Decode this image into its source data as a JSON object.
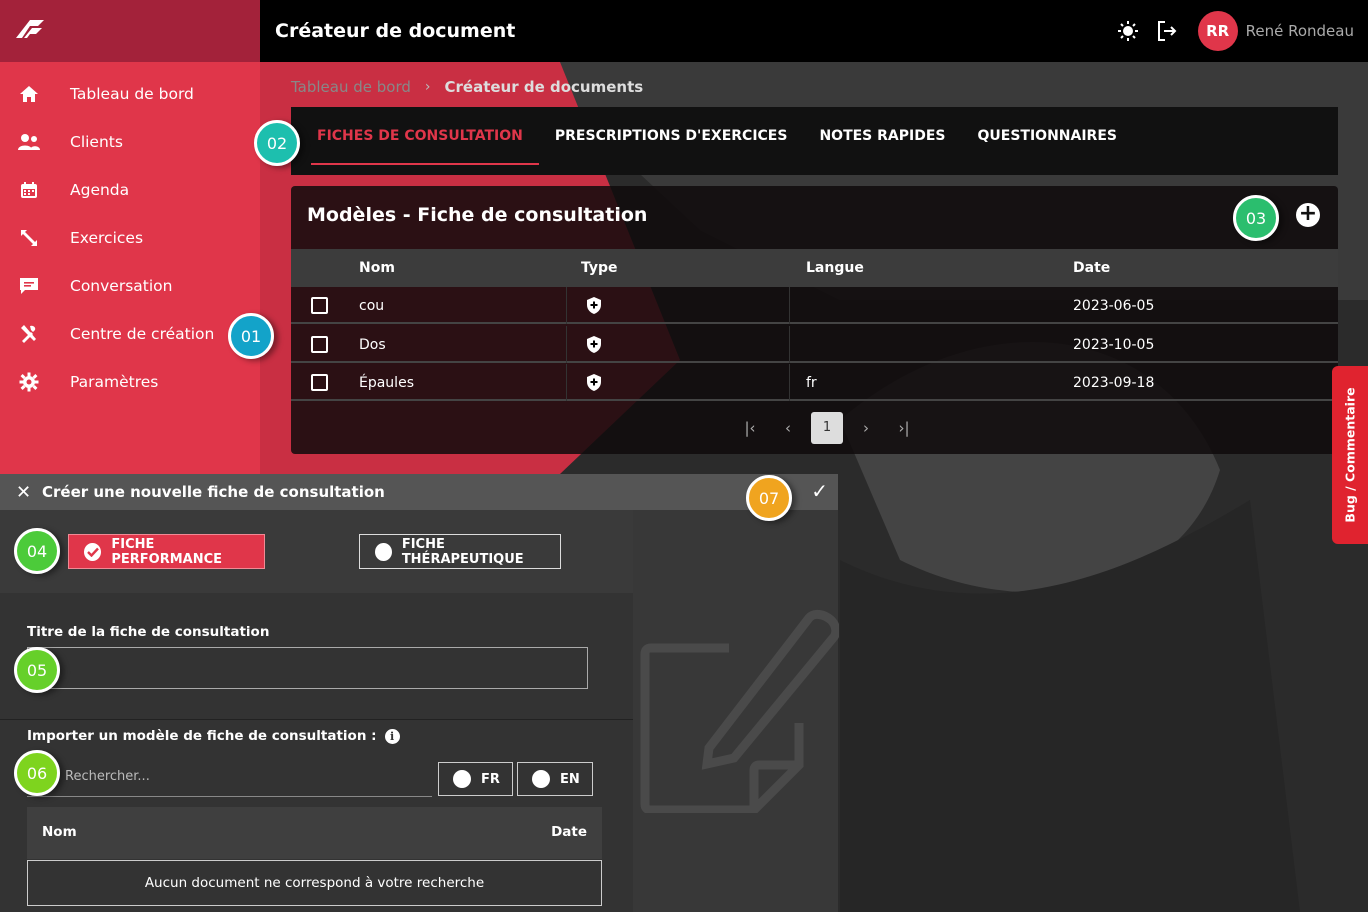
{
  "app": {
    "title": "Créateur de document"
  },
  "user": {
    "initials": "RR",
    "name": "René Rondeau"
  },
  "sidebar": {
    "items": [
      {
        "label": "Tableau de bord",
        "icon": "home-icon"
      },
      {
        "label": "Clients",
        "icon": "users-icon"
      },
      {
        "label": "Agenda",
        "icon": "calendar-icon"
      },
      {
        "label": "Exercices",
        "icon": "exercise-icon"
      },
      {
        "label": "Conversation",
        "icon": "chat-icon"
      },
      {
        "label": "Centre de création",
        "icon": "tools-icon"
      },
      {
        "label": "Paramètres",
        "icon": "gear-icon"
      }
    ]
  },
  "breadcrumb": {
    "item1": "Tableau de bord",
    "separator": "›",
    "item2": "Créateur de documents"
  },
  "tabs": [
    {
      "label": "FICHES DE CONSULTATION",
      "active": true
    },
    {
      "label": "PRESCRIPTIONS D'EXERCICES"
    },
    {
      "label": "NOTES RAPIDES"
    },
    {
      "label": "QUESTIONNAIRES"
    }
  ],
  "templates": {
    "title": "Modèles - Fiche de consultation",
    "add_symbol": "+",
    "columns": {
      "name": "Nom",
      "type": "Type",
      "language": "Langue",
      "date": "Date"
    },
    "rows": [
      {
        "name": "cou",
        "language": "",
        "date": "2023-06-05"
      },
      {
        "name": "Dos",
        "language": "",
        "date": "2023-10-05"
      },
      {
        "name": "Épaules",
        "language": "fr",
        "date": "2023-09-18"
      }
    ],
    "pager": {
      "first": "|‹",
      "prev": "‹",
      "current": "1",
      "next": "›",
      "last": "›|"
    }
  },
  "form": {
    "close_symbol": "✕",
    "title": "Créer une nouvelle fiche de consultation",
    "confirm_symbol": "✓",
    "type_performance": "FICHE PERFORMANCE",
    "type_therapeutic": "FICHE THÉRAPEUTIQUE",
    "title_label": "Titre de la fiche de consultation",
    "title_value": "",
    "import_label": "Importer un modèle de fiche de consultation :",
    "info_symbol": "i",
    "search_placeholder": "Rechercher...",
    "lang_fr": "FR",
    "lang_en": "EN",
    "import_columns": {
      "name": "Nom",
      "date": "Date"
    },
    "empty_message": "Aucun document ne correspond à votre recherche"
  },
  "markers": [
    {
      "label": "01",
      "color": "#13a3c9"
    },
    {
      "label": "02",
      "color": "#1dbfae"
    },
    {
      "label": "03",
      "color": "#2bbe6e"
    },
    {
      "label": "04",
      "color": "#4ccb3a"
    },
    {
      "label": "05",
      "color": "#66d02a"
    },
    {
      "label": "06",
      "color": "#7ed41e"
    },
    {
      "label": "07",
      "color": "#f0a41f"
    }
  ],
  "feedback": {
    "label": "Bug / Commentaire"
  },
  "colors": {
    "accent": "#e0364a",
    "accent_dark": "#a3223a",
    "bg": "#2b2b2b"
  }
}
